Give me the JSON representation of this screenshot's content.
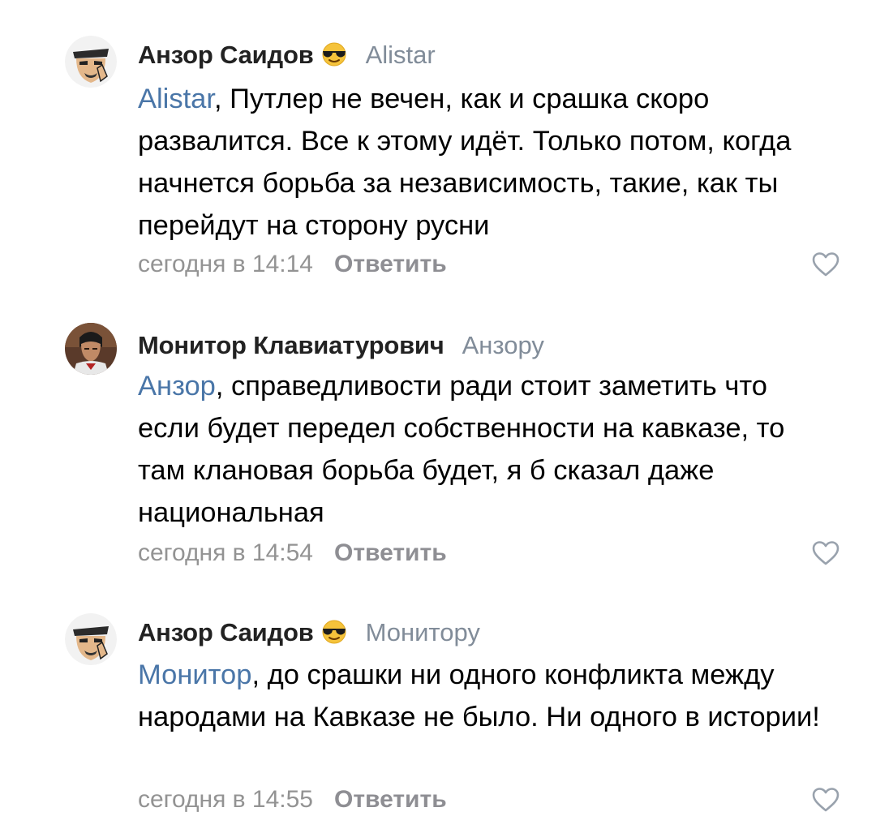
{
  "comments": [
    {
      "author": "Анзор Саидов",
      "author_emoji": "sunglasses-emoji",
      "reply_to": "Alistar",
      "addressee": "Alistar",
      "text": ", Путлер не вечен, как и срашка скоро развалится. Все к этому идёт. Только потом, когда начнется борьба за независимость, такие, как ты перейдут на сторону русни",
      "time": "сегодня в 14:14",
      "reply_label": "Ответить",
      "like_icon": "heart-outline-icon"
    },
    {
      "author": "Монитор Клавиатурович",
      "author_emoji": "",
      "reply_to": "Анзору",
      "addressee": "Анзор",
      "text": ", справедливости ради стоит заметить что если будет передел собственности на кавказе, то там клановая борьба будет, я б сказал даже национальная",
      "time": "сегодня в 14:54",
      "reply_label": "Ответить",
      "like_icon": "heart-outline-icon"
    },
    {
      "author": "Анзор Саидов",
      "author_emoji": "sunglasses-emoji",
      "reply_to": "Монитору",
      "addressee": "Монитор",
      "text": ", до срашки ни одного конфликта между народами на Кавказе не было. Ни одного в истории!",
      "time": "сегодня в 14:55",
      "reply_label": "Ответить",
      "like_icon": "heart-outline-icon"
    }
  ],
  "colors": {
    "addressee_link": "#4a76a8",
    "reply_to": "#818c99",
    "meta": "#939393",
    "author": "#222222"
  }
}
